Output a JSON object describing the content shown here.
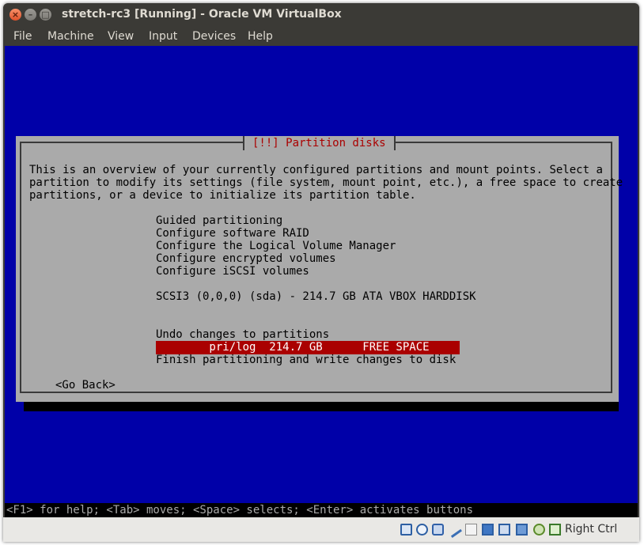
{
  "window": {
    "title": "stretch-rc3 [Running] - Oracle VM VirtualBox",
    "menu": [
      "File",
      "Machine",
      "View",
      "Input",
      "Devices",
      "Help"
    ]
  },
  "dialog": {
    "title": "[!!] Partition disks",
    "description": [
      "This is an overview of your currently configured partitions and mount points. Select a",
      "partition to modify its settings (file system, mount point, etc.), a free space to create",
      "partitions, or a device to initialize its partition table."
    ],
    "options": [
      "Guided partitioning",
      "Configure software RAID",
      "Configure the Logical Volume Manager",
      "Configure encrypted volumes",
      "Configure iSCSI volumes"
    ],
    "disk": "SCSI3 (0,0,0) (sda) - 214.7 GB ATA VBOX HARDDISK",
    "selected_partition": "        pri/log  214.7 GB      FREE SPACE",
    "actions": [
      "Undo changes to partitions",
      "Finish partitioning and write changes to disk"
    ],
    "go_back": "<Go Back>"
  },
  "help_line": "<F1> for help; <Tab> moves; <Space> selects; <Enter> activates buttons",
  "statusbar": {
    "host_key": "Right Ctrl",
    "icons": [
      "hard-disk-icon",
      "optical-drive-icon",
      "usb-icon",
      "pen-icon",
      "shared-folder-icon",
      "display-icon",
      "network-icon",
      "video-capture-icon",
      "cpu-icon",
      "mouse-integration-icon"
    ]
  }
}
